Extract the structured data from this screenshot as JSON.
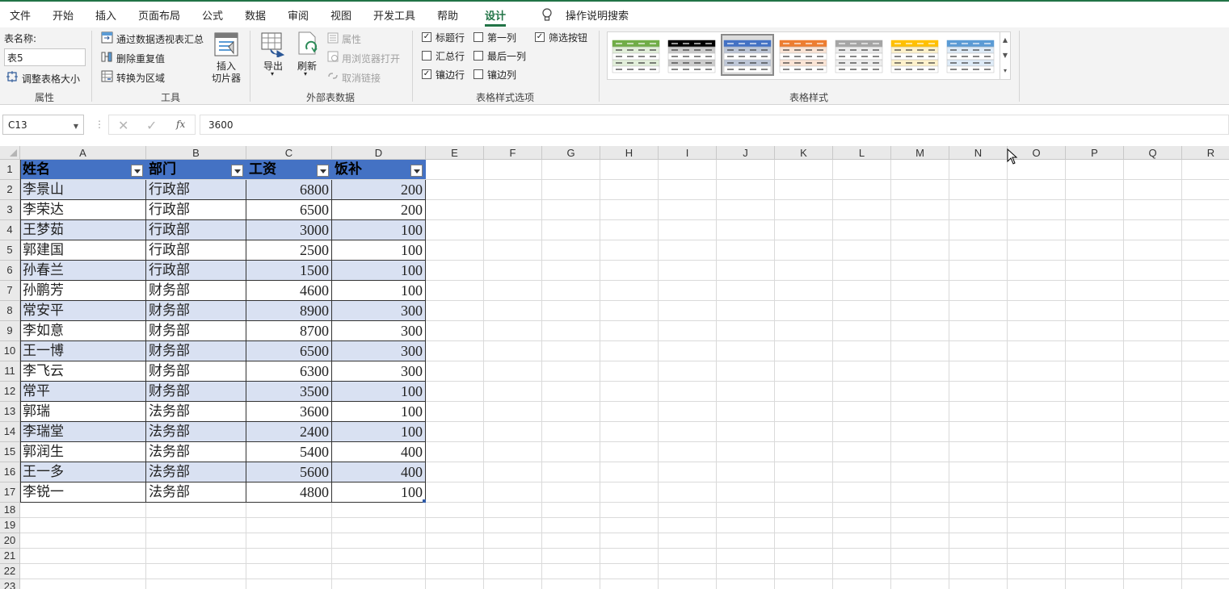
{
  "menu": {
    "tabs": [
      "文件",
      "开始",
      "插入",
      "页面布局",
      "公式",
      "数据",
      "审阅",
      "视图",
      "开发工具",
      "帮助",
      "设计"
    ],
    "active": "设计",
    "tell_me": "操作说明搜索"
  },
  "ribbon": {
    "properties": {
      "table_name_label": "表名称:",
      "table_name_value": "表5",
      "resize_label": "调整表格大小",
      "group_label": "属性"
    },
    "tools": {
      "summarize_pivot": "通过数据透视表汇总",
      "remove_duplicates": "删除重复值",
      "convert_to_range": "转换为区域",
      "insert_slicer_line1": "插入",
      "insert_slicer_line2": "切片器",
      "group_label": "工具"
    },
    "external": {
      "export": "导出",
      "refresh": "刷新",
      "properties": "属性",
      "open_in_browser": "用浏览器打开",
      "unlink": "取消链接",
      "group_label": "外部表数据"
    },
    "style_options": {
      "header_row": "标题行",
      "total_row": "汇总行",
      "banded_rows": "镶边行",
      "first_column": "第一列",
      "last_column": "最后一列",
      "banded_columns": "镶边列",
      "filter_button": "筛选按钮",
      "header_row_checked": true,
      "total_row_checked": false,
      "banded_rows_checked": true,
      "first_column_checked": false,
      "last_column_checked": false,
      "banded_columns_checked": false,
      "filter_button_checked": true,
      "group_label": "表格样式选项"
    },
    "table_styles": {
      "group_label": "表格样式",
      "swatches": [
        "#70ad47",
        "#000000",
        "#4472c4",
        "#ed7d31",
        "#a5a5a5",
        "#ffc000",
        "#5b9bd5"
      ],
      "selected_index": 2
    }
  },
  "formula_bar": {
    "name_box": "C13",
    "fx": "fx",
    "value": "3600"
  },
  "sheet": {
    "columns": [
      "A",
      "B",
      "C",
      "D",
      "E",
      "F",
      "G",
      "H",
      "I",
      "J",
      "K",
      "L",
      "M",
      "N",
      "O",
      "P",
      "Q",
      "R"
    ],
    "rows": [
      "1",
      "2",
      "3",
      "4",
      "5",
      "6",
      "7",
      "8",
      "9",
      "10",
      "11",
      "12",
      "13",
      "14",
      "15",
      "16",
      "17",
      "18",
      "19",
      "20",
      "21",
      "22",
      "23"
    ],
    "table_headers": [
      "姓名",
      "部门",
      "工资",
      "饭补"
    ],
    "table_rows": [
      [
        "李景山",
        "行政部",
        "6800",
        "200"
      ],
      [
        "李荣达",
        "行政部",
        "6500",
        "200"
      ],
      [
        "王梦茹",
        "行政部",
        "3000",
        "100"
      ],
      [
        "郭建国",
        "行政部",
        "2500",
        "100"
      ],
      [
        "孙春兰",
        "行政部",
        "1500",
        "100"
      ],
      [
        "孙鹏芳",
        "财务部",
        "4600",
        "100"
      ],
      [
        "常安平",
        "财务部",
        "8900",
        "300"
      ],
      [
        "李如意",
        "财务部",
        "8700",
        "300"
      ],
      [
        "王一博",
        "财务部",
        "6500",
        "300"
      ],
      [
        "李飞云",
        "财务部",
        "6300",
        "300"
      ],
      [
        "常平",
        "财务部",
        "3500",
        "100"
      ],
      [
        "郭瑞",
        "法务部",
        "3600",
        "100"
      ],
      [
        "李瑞堂",
        "法务部",
        "2400",
        "100"
      ],
      [
        "郭润生",
        "法务部",
        "5400",
        "400"
      ],
      [
        "王一多",
        "法务部",
        "5600",
        "400"
      ],
      [
        "李锐一",
        "法务部",
        "4800",
        "100"
      ]
    ],
    "colors": {
      "header_fill": "#4472c4",
      "band_fill": "#d9e1f2",
      "accent": "#217346"
    }
  }
}
